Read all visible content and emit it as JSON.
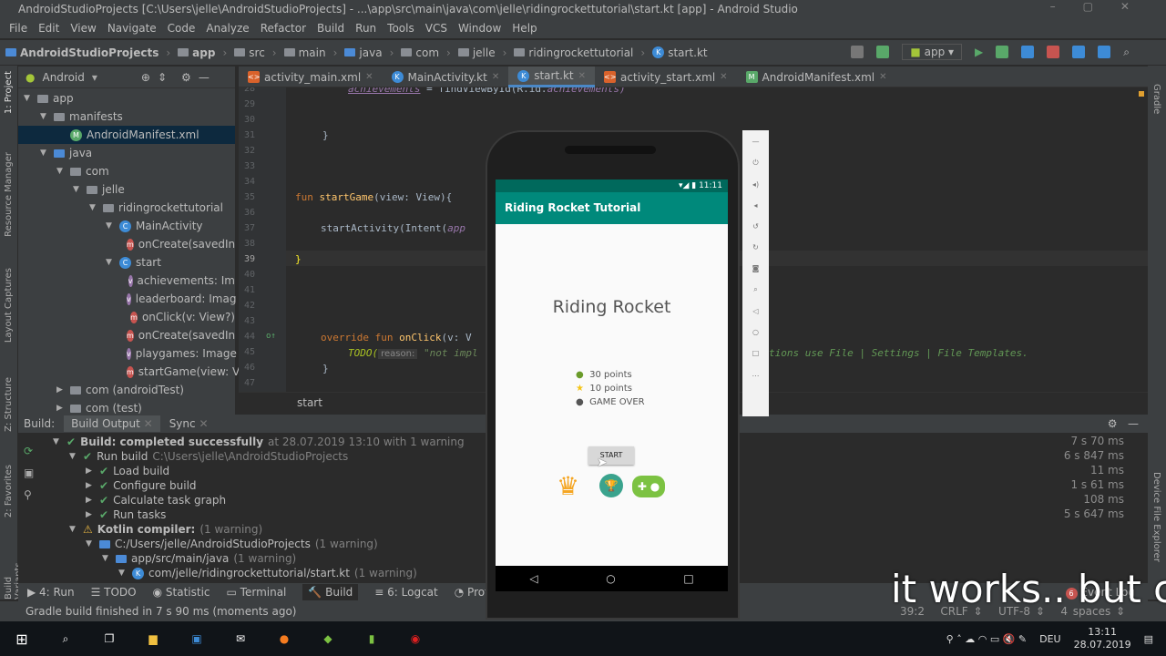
{
  "window": {
    "title": "AndroidStudioProjects [C:\\Users\\jelle\\AndroidStudioProjects] - ...\\app\\src\\main\\java\\com\\jelle\\ridingrockettutorial\\start.kt [app] - Android Studio"
  },
  "menu": [
    "File",
    "Edit",
    "View",
    "Navigate",
    "Code",
    "Analyze",
    "Refactor",
    "Build",
    "Run",
    "Tools",
    "VCS",
    "Window",
    "Help"
  ],
  "breadcrumb": [
    "AndroidStudioProjects",
    "app",
    "src",
    "main",
    "java",
    "com",
    "jelle",
    "ridingrockettutorial",
    "start.kt"
  ],
  "run_config": "app",
  "project_panel": {
    "view": "Android",
    "stripe_labels": [
      "1: Project",
      "Resource Manager",
      "Layout Captures",
      "Z: Structure",
      "2: Favorites",
      "Build Variants"
    ],
    "tree": [
      {
        "label": "app",
        "depth": 0,
        "icon": "folder"
      },
      {
        "label": "manifests",
        "depth": 1,
        "icon": "folder"
      },
      {
        "label": "AndroidManifest.xml",
        "depth": 2,
        "icon": "xml",
        "selected": true
      },
      {
        "label": "java",
        "depth": 1,
        "icon": "folder"
      },
      {
        "label": "com",
        "depth": 2,
        "icon": "folder"
      },
      {
        "label": "jelle",
        "depth": 3,
        "icon": "folder"
      },
      {
        "label": "ridingrockettutorial",
        "depth": 4,
        "icon": "folder"
      },
      {
        "label": "MainActivity",
        "depth": 5,
        "icon": "class"
      },
      {
        "label": "onCreate(savedIn",
        "depth": 6,
        "icon": "m"
      },
      {
        "label": "start",
        "depth": 5,
        "icon": "class"
      },
      {
        "label": "achievements: Im",
        "depth": 6,
        "icon": "v"
      },
      {
        "label": "leaderboard: Imag",
        "depth": 6,
        "icon": "v"
      },
      {
        "label": "onClick(v: View?)",
        "depth": 6,
        "icon": "m"
      },
      {
        "label": "onCreate(savedIn",
        "depth": 6,
        "icon": "m"
      },
      {
        "label": "playgames: Image",
        "depth": 6,
        "icon": "v"
      },
      {
        "label": "startGame(view: V",
        "depth": 6,
        "icon": "m"
      },
      {
        "label": "com (androidTest)",
        "depth": 2,
        "icon": "folder"
      },
      {
        "label": "com (test)",
        "depth": 2,
        "icon": "folder"
      }
    ]
  },
  "tabs": [
    {
      "label": "activity_main.xml"
    },
    {
      "label": "MainActivity.kt"
    },
    {
      "label": "start.kt",
      "active": true
    },
    {
      "label": "activity_start.xml"
    },
    {
      "label": "AndroidManifest.xml"
    }
  ],
  "editor": {
    "line_numbers": [
      "28",
      "29",
      "30",
      "31",
      "32",
      "33",
      "34",
      "35",
      "36",
      "37",
      "38",
      "39",
      "40",
      "41",
      "42",
      "43",
      "44",
      "45",
      "46",
      "47"
    ],
    "lines": {
      "l28a": "achievements",
      "l28b": " = findViewById(R.id.",
      "l28c": "achievements)",
      "l31": "}",
      "l35a": "fun ",
      "l35b": "startGame",
      "l35c": "(view: View){",
      "l37a": "startActivity(Intent(",
      "l37b": "app",
      "l39": "}",
      "l44a": "override fun ",
      "l44b": "onClick",
      "l44c": "(v: V",
      "l45a": "TODO(",
      "l45hint": "reason:",
      "l45b": " \"not impl",
      "l46": "}",
      "right": "tions use File | Settings | File Templates."
    },
    "footer_crumb": "start"
  },
  "build": {
    "tabs": [
      "Build:",
      "Build Output",
      "Sync"
    ],
    "rows": [
      {
        "text": "Build: completed successfully",
        "meta": " at 28.07.2019 13:10  with 1 warning",
        "icon": "check",
        "depth": 0,
        "time": "7 s 70 ms"
      },
      {
        "text": "Run build",
        "meta": " C:\\Users\\jelle\\AndroidStudioProjects",
        "icon": "check",
        "depth": 1,
        "time": "6 s 847 ms"
      },
      {
        "text": "Load build",
        "meta": "",
        "icon": "check",
        "depth": 2,
        "time": "11 ms"
      },
      {
        "text": "Configure build",
        "meta": "",
        "icon": "check",
        "depth": 2,
        "time": "1 s 61 ms"
      },
      {
        "text": "Calculate task graph",
        "meta": "",
        "icon": "check",
        "depth": 2,
        "time": "108 ms"
      },
      {
        "text": "Run tasks",
        "meta": "",
        "icon": "check",
        "depth": 2,
        "time": "5 s 647 ms"
      },
      {
        "text": "Kotlin compiler:",
        "meta": " (1 warning)",
        "icon": "warn",
        "depth": 1,
        "time": ""
      },
      {
        "text": "C:/Users/jelle/AndroidStudioProjects",
        "meta": " (1 warning)",
        "icon": "folder",
        "depth": 2,
        "time": ""
      },
      {
        "text": "app/src/main/java",
        "meta": " (1 warning)",
        "icon": "folder",
        "depth": 3,
        "time": ""
      },
      {
        "text": "com/jelle/ridingrockettutorial/start.kt",
        "meta": " (1 warning)",
        "icon": "file",
        "depth": 4,
        "time": ""
      }
    ]
  },
  "bottom_tabs": [
    "4: Run",
    "TODO",
    "Statistic",
    "Terminal",
    "Build",
    "6: Logcat",
    "Profiler"
  ],
  "event_log": {
    "count": "6",
    "label": "Event Log"
  },
  "status": {
    "message": "Gradle build finished in 7 s 90 ms (moments ago)",
    "position": "39:2",
    "line_sep": "CRLF",
    "encoding": "UTF-8",
    "indent": "4 spaces"
  },
  "right_stripe": [
    "Gradle",
    "Device File Explorer"
  ],
  "phone": {
    "time": "11:11",
    "app_title": "Riding Rocket Tutorial",
    "heading": "Riding Rocket",
    "items": [
      "30 points",
      "10 points",
      "GAME OVER"
    ],
    "button": "START"
  },
  "subtitle": "it works.. but c",
  "taskbar": {
    "lang": "DEU",
    "time": "13:11",
    "date": "28.07.2019"
  },
  "colors": {
    "teal": "#00897b",
    "teal_dark": "#00695c",
    "ide_bg": "#2b2b2b",
    "panel": "#3c3f41"
  }
}
